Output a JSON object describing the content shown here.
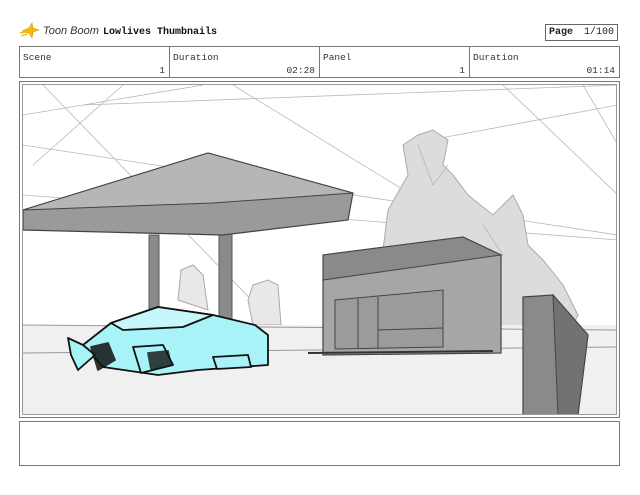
{
  "app": {
    "logo_text": "Toon Boom",
    "document_title": "Lowlives Thumbnails"
  },
  "page": {
    "label": "Page",
    "value": "1/100"
  },
  "meta": {
    "scene_label": "Scene",
    "scene_value": "1",
    "scene_duration_label": "Duration",
    "scene_duration_value": "02:28",
    "panel_label": "Panel",
    "panel_value": "1",
    "panel_duration_label": "Duration",
    "panel_duration_value": "01:14"
  },
  "colors": {
    "accent_logo": "#f2b817",
    "car_highlight": "#a8f3f8",
    "sketch_gray": "#8c8c8c"
  },
  "icons": {
    "logo": "toon-boom-star-icon"
  }
}
